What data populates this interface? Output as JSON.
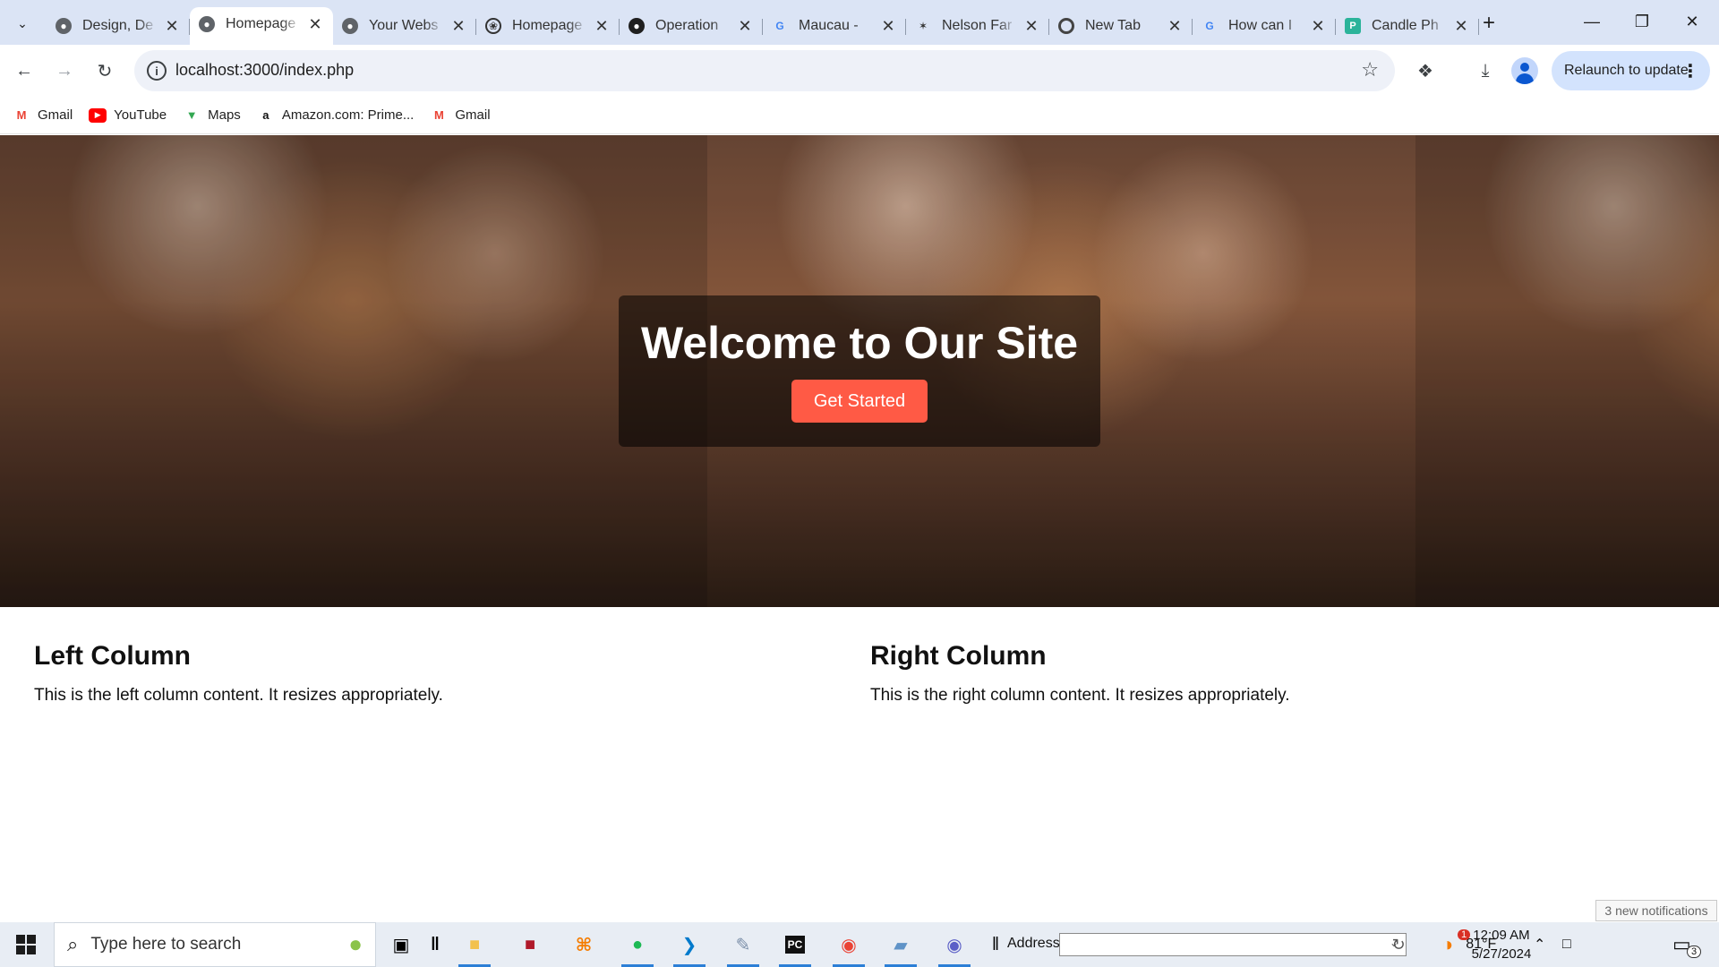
{
  "browser": {
    "tabs": [
      {
        "title": "Design, De",
        "favicon": "globe-icon",
        "active": false
      },
      {
        "title": "Homepage",
        "favicon": "globe-icon",
        "active": true
      },
      {
        "title": "Your Webs",
        "favicon": "globe-icon",
        "active": false
      },
      {
        "title": "Homepage",
        "favicon": "openai-icon",
        "active": false
      },
      {
        "title": "Operation",
        "favicon": "github-icon",
        "active": false
      },
      {
        "title": "Maucau - ",
        "favicon": "google-icon",
        "active": false
      },
      {
        "title": "Nelson Far",
        "favicon": "bike-icon",
        "active": false
      },
      {
        "title": "New Tab",
        "favicon": "chrome-icon",
        "active": false
      },
      {
        "title": "How can I",
        "favicon": "google-icon",
        "active": false
      },
      {
        "title": "Candle Ph",
        "favicon": "canva-icon",
        "active": false
      }
    ],
    "url": "localhost:3000/index.php",
    "relaunch_label": "Relaunch to update",
    "bookmarks": [
      {
        "label": "Gmail",
        "icon": "gmail-icon"
      },
      {
        "label": "YouTube",
        "icon": "youtube-icon"
      },
      {
        "label": "Maps",
        "icon": "maps-icon"
      },
      {
        "label": "Amazon.com: Prime...",
        "icon": "amazon-icon"
      },
      {
        "label": "Gmail",
        "icon": "gmail-icon"
      }
    ]
  },
  "page": {
    "hero_title": "Welcome to Our Site",
    "cta_label": "Get Started",
    "left": {
      "heading": "Left Column",
      "text": "This is the left column content. It resizes appropriately."
    },
    "right": {
      "heading": "Right Column",
      "text": "This is the right column content. It resizes appropriately."
    }
  },
  "taskbar": {
    "search_placeholder": "Type here to search",
    "address_label": "Address",
    "weather": "81°F",
    "time": "12:09 AM",
    "date": "5/27/2024",
    "notification_chip": "3 new notifications",
    "notification_count": "3",
    "weather_badge": "1"
  },
  "colors": {
    "accent_button": "#ff5a45",
    "tabstrip_bg": "#dbe4f5",
    "relaunch_bg": "#d3e3fd"
  }
}
